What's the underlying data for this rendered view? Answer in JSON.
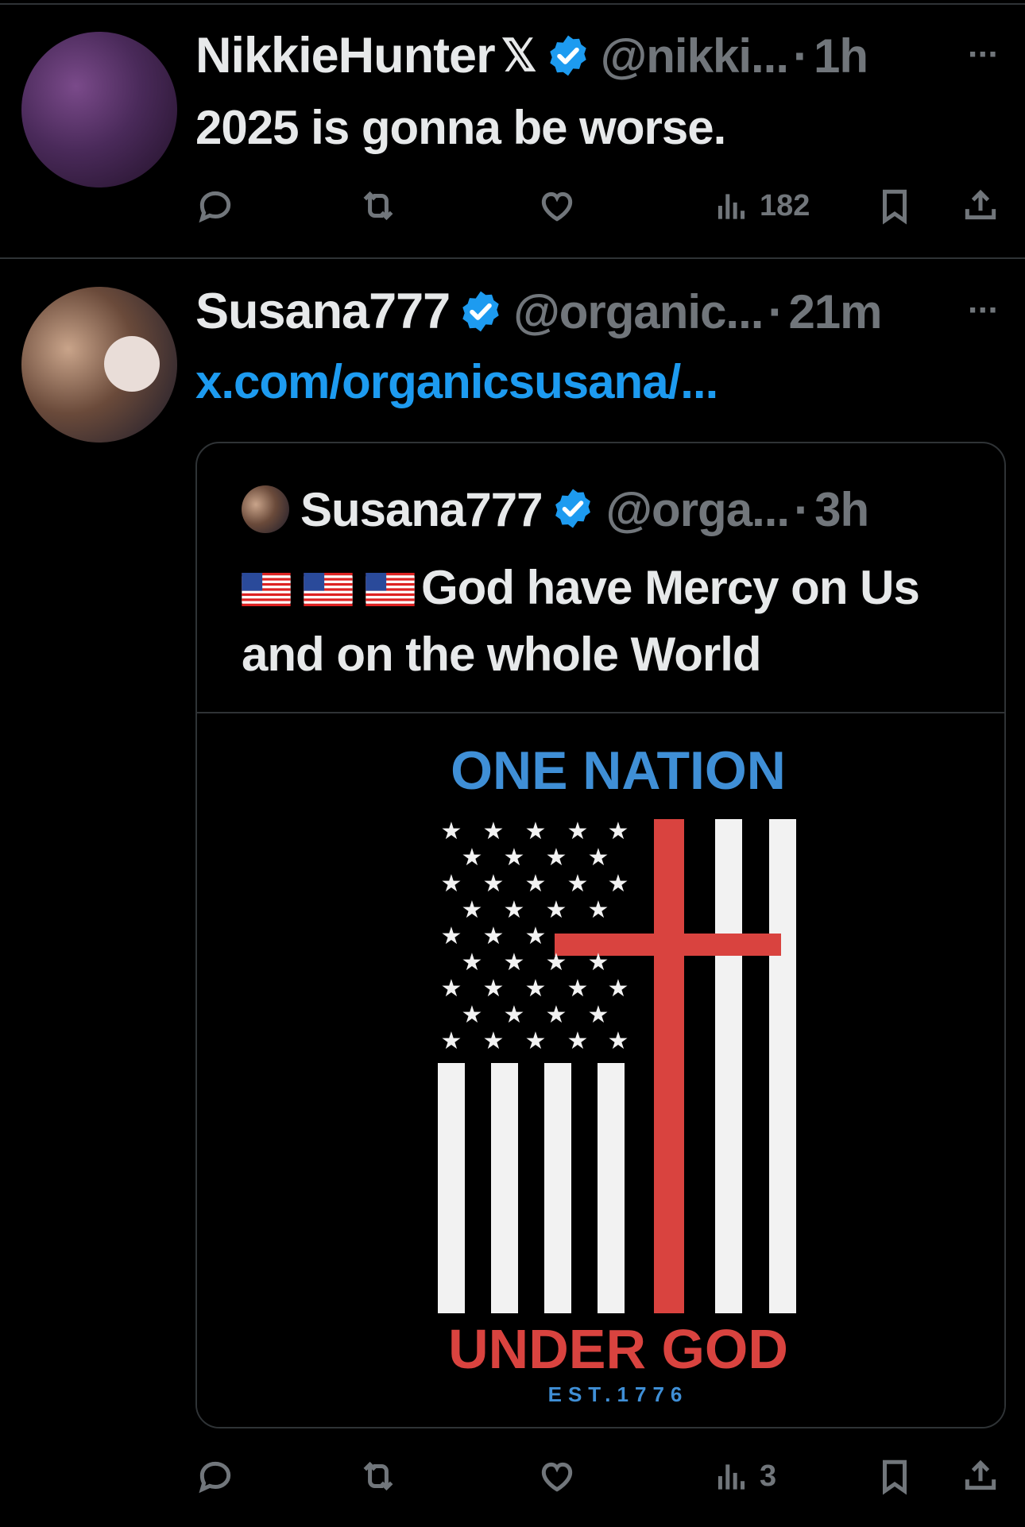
{
  "tweets": [
    {
      "name": "NikkieHunter",
      "handle": "@nikki...",
      "separator": "·",
      "time": "1h",
      "text": "2025 is gonna be worse.",
      "more": "···",
      "stats": {
        "views": "182"
      }
    },
    {
      "name": "Susana777",
      "handle": "@organic...",
      "separator": "·",
      "time": "21m",
      "link": "x.com/organicsusana/...",
      "more": "···",
      "stats": {
        "views": "3"
      },
      "quote": {
        "name": "Susana777",
        "handle": "@orga...",
        "separator": "·",
        "time": "3h",
        "text": "God have Mercy on Us and on the whole World",
        "image": {
          "top_text": "ONE NATION",
          "bottom_text": "UNDER GOD",
          "small_text": "EST.1776"
        }
      }
    }
  ],
  "colors": {
    "accent": "#1d9bf0",
    "muted": "#71767b",
    "text": "#e7e9ea",
    "cross": "#d9433f"
  },
  "icons": [
    "reply-icon",
    "retweet-icon",
    "like-icon",
    "views-icon",
    "bookmark-icon",
    "share-icon",
    "verified-badge-icon",
    "x-logo-icon",
    "us-flag-icon"
  ]
}
